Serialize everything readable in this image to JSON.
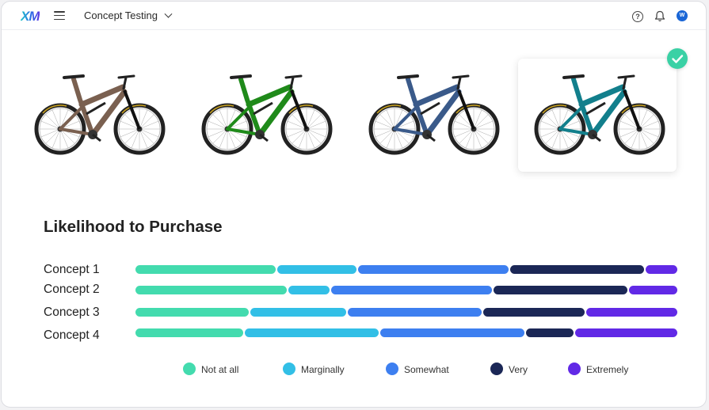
{
  "header": {
    "logo": "XM",
    "project_name": "Concept Testing"
  },
  "avatar_initial": "W",
  "icons": [
    "menu-icon",
    "chevron-down-icon",
    "help-icon",
    "bell-icon",
    "check-icon"
  ],
  "colors": {
    "not_at_all": "#43dbae",
    "marginally": "#32bfe6",
    "somewhat": "#3d7ff0",
    "very": "#1b2756",
    "extremely": "#6129e6",
    "bike_brown": "#7a6050",
    "bike_green": "#1f8a1a",
    "bike_blue": "#3a5a8a",
    "bike_teal": "#127f8c"
  },
  "selected_concept": 4,
  "chart_data": {
    "type": "bar",
    "stacked": true,
    "orientation": "horizontal",
    "title": "Likelihood to Purchase",
    "categories": [
      "Concept 1",
      "Concept 2",
      "Concept 3",
      "Concept 4"
    ],
    "series": [
      {
        "name": "Not at all",
        "values": [
          26,
          28,
          21,
          20
        ]
      },
      {
        "name": "Marginally",
        "values": [
          15,
          8,
          18,
          25
        ]
      },
      {
        "name": "Somewhat",
        "values": [
          28,
          30,
          25,
          27
        ]
      },
      {
        "name": "Very",
        "values": [
          25,
          25,
          19,
          9
        ]
      },
      {
        "name": "Extremely",
        "values": [
          6,
          9,
          17,
          19
        ]
      }
    ],
    "legend_position": "bottom"
  }
}
